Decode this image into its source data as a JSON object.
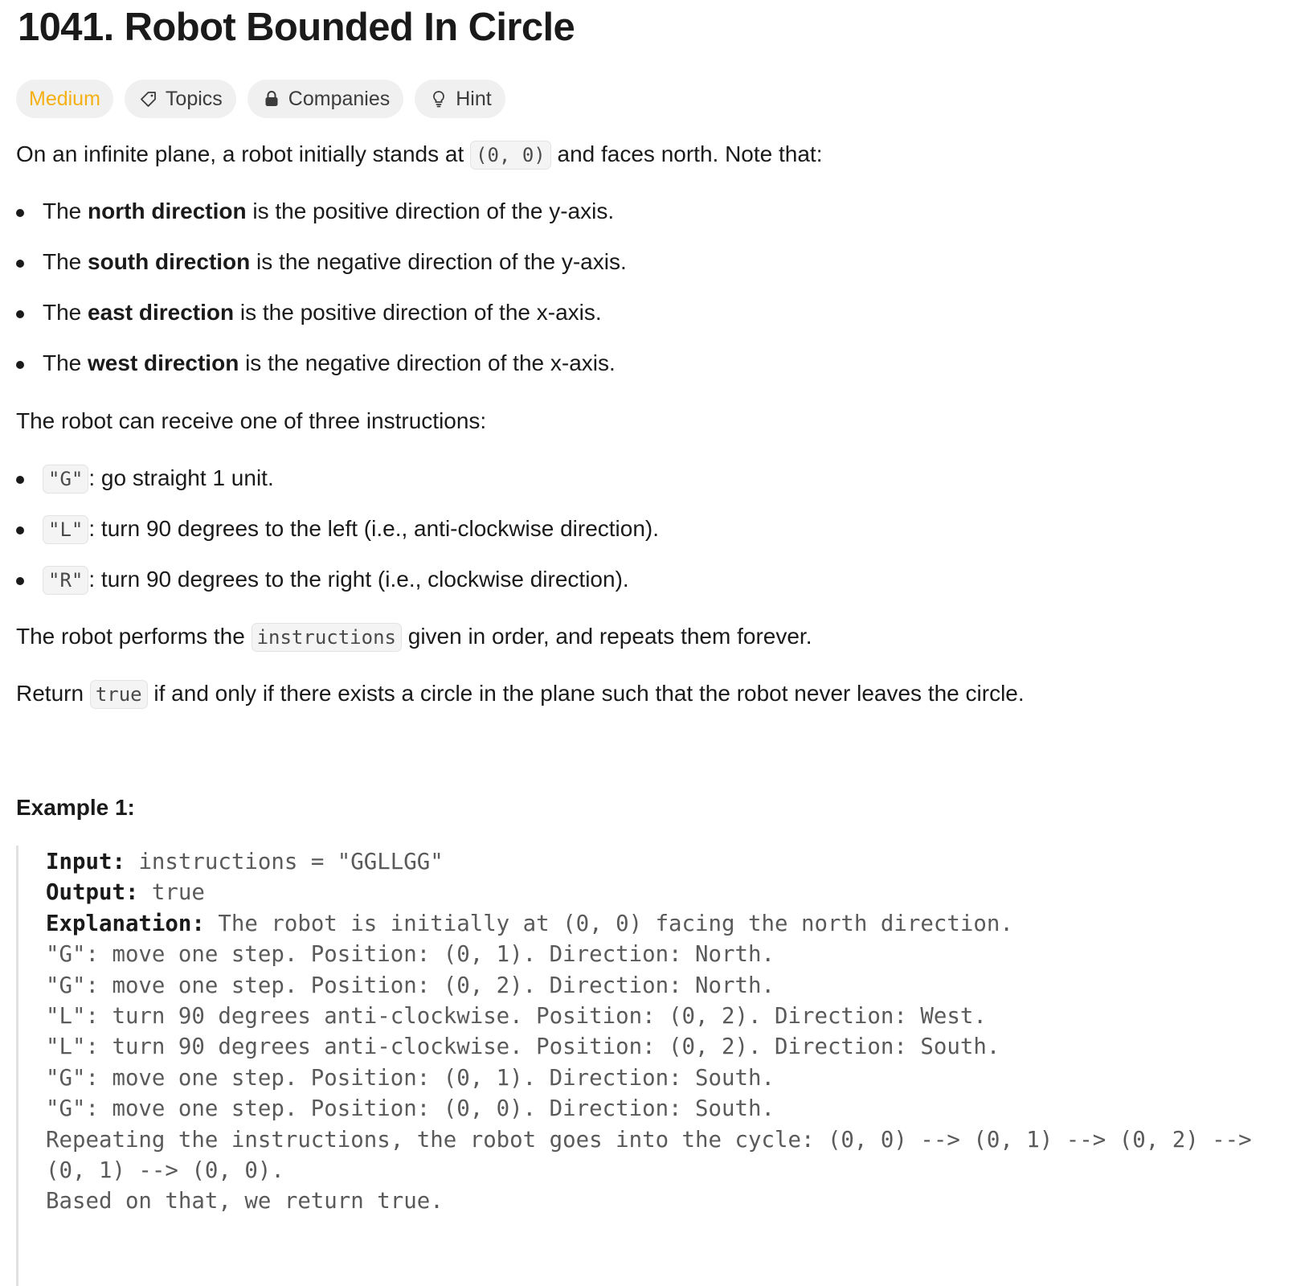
{
  "title": "1041. Robot Bounded In Circle",
  "tags": {
    "difficulty": "Medium",
    "topics": "Topics",
    "companies": "Companies",
    "hint": "Hint"
  },
  "intro": {
    "pre": "On an infinite plane, a robot initially stands at ",
    "code": "(0, 0)",
    "post": " and faces north. Note that:"
  },
  "directions": [
    {
      "pre": "The ",
      "bold": "north direction",
      "post": " is the positive direction of the y-axis."
    },
    {
      "pre": "The ",
      "bold": "south direction",
      "post": " is the negative direction of the y-axis."
    },
    {
      "pre": "The ",
      "bold": "east direction",
      "post": " is the positive direction of the x-axis."
    },
    {
      "pre": "The ",
      "bold": "west direction",
      "post": " is the negative direction of the x-axis."
    }
  ],
  "instructions_intro": "The robot can receive one of three instructions:",
  "instructions": [
    {
      "code": "\"G\"",
      "text": ": go straight 1 unit."
    },
    {
      "code": "\"L\"",
      "text": ": turn 90 degrees to the left (i.e., anti-clockwise direction)."
    },
    {
      "code": "\"R\"",
      "text": ": turn 90 degrees to the right (i.e., clockwise direction)."
    }
  ],
  "performs": {
    "pre": "The robot performs the ",
    "code": "instructions",
    "post": " given in order, and repeats them forever."
  },
  "return_line": {
    "pre": "Return ",
    "code": "true",
    "post": " if and only if there exists a circle in the plane such that the robot never leaves the circle."
  },
  "example1": {
    "title": "Example 1:",
    "input_label": "Input:",
    "input_value": " instructions = \"GGLLGG\"",
    "output_label": "Output:",
    "output_value": " true",
    "explanation_label": "Explanation:",
    "explanation_value": " The robot is initially at (0, 0) facing the north direction.",
    "lines": [
      "\"G\": move one step. Position: (0, 1). Direction: North.",
      "\"G\": move one step. Position: (0, 2). Direction: North.",
      "\"L\": turn 90 degrees anti-clockwise. Position: (0, 2). Direction: West.",
      "\"L\": turn 90 degrees anti-clockwise. Position: (0, 2). Direction: South.",
      "\"G\": move one step. Position: (0, 1). Direction: South.",
      "\"G\": move one step. Position: (0, 0). Direction: South.",
      "Repeating the instructions, the robot goes into the cycle: (0, 0) --> (0, 1) --> (0, 2) -->",
      "(0, 1) --> (0, 0).",
      "Based on that, we return true."
    ]
  },
  "icons": {
    "topics": "tag-icon",
    "companies": "lock-icon",
    "hint": "lightbulb-icon"
  },
  "colors": {
    "difficulty_medium": "#f5b014",
    "text": "#1a1a1a",
    "tag_bg": "#f0f0f1"
  }
}
